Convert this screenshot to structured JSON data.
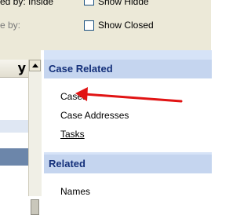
{
  "toolbar": {
    "row1_label": "ed by: Inside",
    "row1_checkbox_label": "Show Hidde",
    "row2_label": "e by:",
    "row2_checkbox_label": "Show Closed"
  },
  "left_panel": {
    "header_label": "y",
    "rows": [
      "",
      "",
      "",
      "",
      ""
    ]
  },
  "task_pane": {
    "sections": [
      {
        "title": "Case Related",
        "items": [
          "Cases",
          "Case Addresses",
          "Tasks"
        ]
      },
      {
        "title": "Related",
        "items": [
          "Names"
        ]
      }
    ]
  },
  "annotation": {
    "arrow_color": "#e11414"
  },
  "colors": {
    "toolbar_bg": "#ece9d8",
    "pane_bg": "#d6e3f7",
    "section_header_bg": "#c5d5ef",
    "section_header_text": "#14307a"
  }
}
